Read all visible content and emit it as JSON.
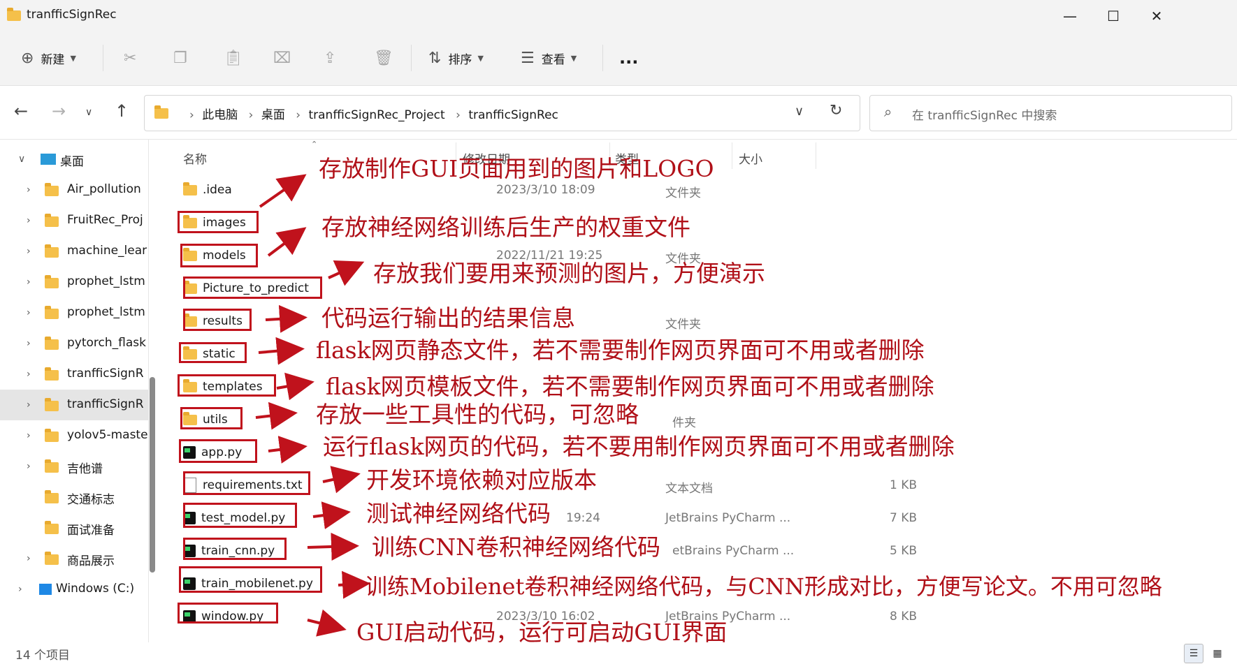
{
  "window": {
    "title": "tranfficSignRec"
  },
  "toolbar": {
    "new_label": "新建",
    "sort_label": "排序",
    "view_label": "查看",
    "more_label": "..."
  },
  "address": {
    "crumbs": [
      "此电脑",
      "桌面",
      "tranfficSignRec_Project",
      "tranfficSignRec"
    ],
    "search_placeholder": "在 tranfficSignRec 中搜索"
  },
  "sidebar": {
    "items": [
      {
        "label": "桌面"
      },
      {
        "label": "Air_pollution"
      },
      {
        "label": "FruitRec_Proj"
      },
      {
        "label": "machine_lear"
      },
      {
        "label": "prophet_lstm"
      },
      {
        "label": "prophet_lstm"
      },
      {
        "label": "pytorch_flask"
      },
      {
        "label": "tranfficSignR"
      },
      {
        "label": "tranfficSignR"
      },
      {
        "label": "yolov5-maste"
      },
      {
        "label": "吉他谱"
      },
      {
        "label": "交通标志"
      },
      {
        "label": "面试准备"
      },
      {
        "label": "商品展示"
      },
      {
        "label": "Windows (C:)"
      }
    ]
  },
  "columns": {
    "name": "名称",
    "date": "修改日期",
    "type": "类型",
    "size": "大小"
  },
  "files": [
    {
      "name": ".idea",
      "date": "2023/3/10 18:09",
      "type": "文件夹",
      "size": ""
    },
    {
      "name": "images",
      "date": "",
      "type": "",
      "size": ""
    },
    {
      "name": "models",
      "date": "2022/11/21 19:25",
      "type": "文件夹",
      "size": ""
    },
    {
      "name": "Picture_to_predict",
      "date": "",
      "type": "",
      "size": ""
    },
    {
      "name": "results",
      "date": "",
      "type": "文件夹",
      "size": ""
    },
    {
      "name": "static",
      "date": "",
      "type": "",
      "size": ""
    },
    {
      "name": "templates",
      "date": "",
      "type": "",
      "size": ""
    },
    {
      "name": "utils",
      "date": "",
      "type": "件夹",
      "size": ""
    },
    {
      "name": "app.py",
      "date": "",
      "type": "",
      "size": ""
    },
    {
      "name": "requirements.txt",
      "date": "",
      "type": "文本文档",
      "size": "1 KB"
    },
    {
      "name": "test_model.py",
      "date": "19:24",
      "type": "JetBrains PyCharm ...",
      "size": "7 KB"
    },
    {
      "name": "train_cnn.py",
      "date": "",
      "type": "etBrains PyCharm ...",
      "size": "5 KB"
    },
    {
      "name": "train_mobilenet.py",
      "date": "",
      "type": "",
      "size": ""
    },
    {
      "name": "window.py",
      "date": "2023/3/10 16:02",
      "type": "JetBrains PyCharm ...",
      "size": "8 KB"
    }
  ],
  "annotations": [
    "存放制作GUI页面用到的图片和LOGO",
    "存放神经网络训练后生产的权重文件",
    "存放我们要用来预测的图片，方便演示",
    "代码运行输出的结果信息",
    "flask网页静态文件，若不需要制作网页界面可不用或者删除",
    "flask网页模板文件，若不需要制作网页界面可不用或者删除",
    "存放一些工具性的代码，可忽略",
    "运行flask网页的代码，若不要用制作网页界面可不用或者删除",
    "开发环境依赖对应版本",
    "测试神经网络代码",
    "训练CNN卷积神经网络代码",
    "训练Mobilenet卷积神经网络代码，与CNN形成对比，方便写论文。不用可忽略",
    "GUI启动代码，运行可启动GUI界面"
  ],
  "status": {
    "item_count": "14 个项目"
  },
  "colors": {
    "annotation_red": "#b01018",
    "box_red": "#c0121c",
    "folder_yellow": "#f5c04a"
  }
}
